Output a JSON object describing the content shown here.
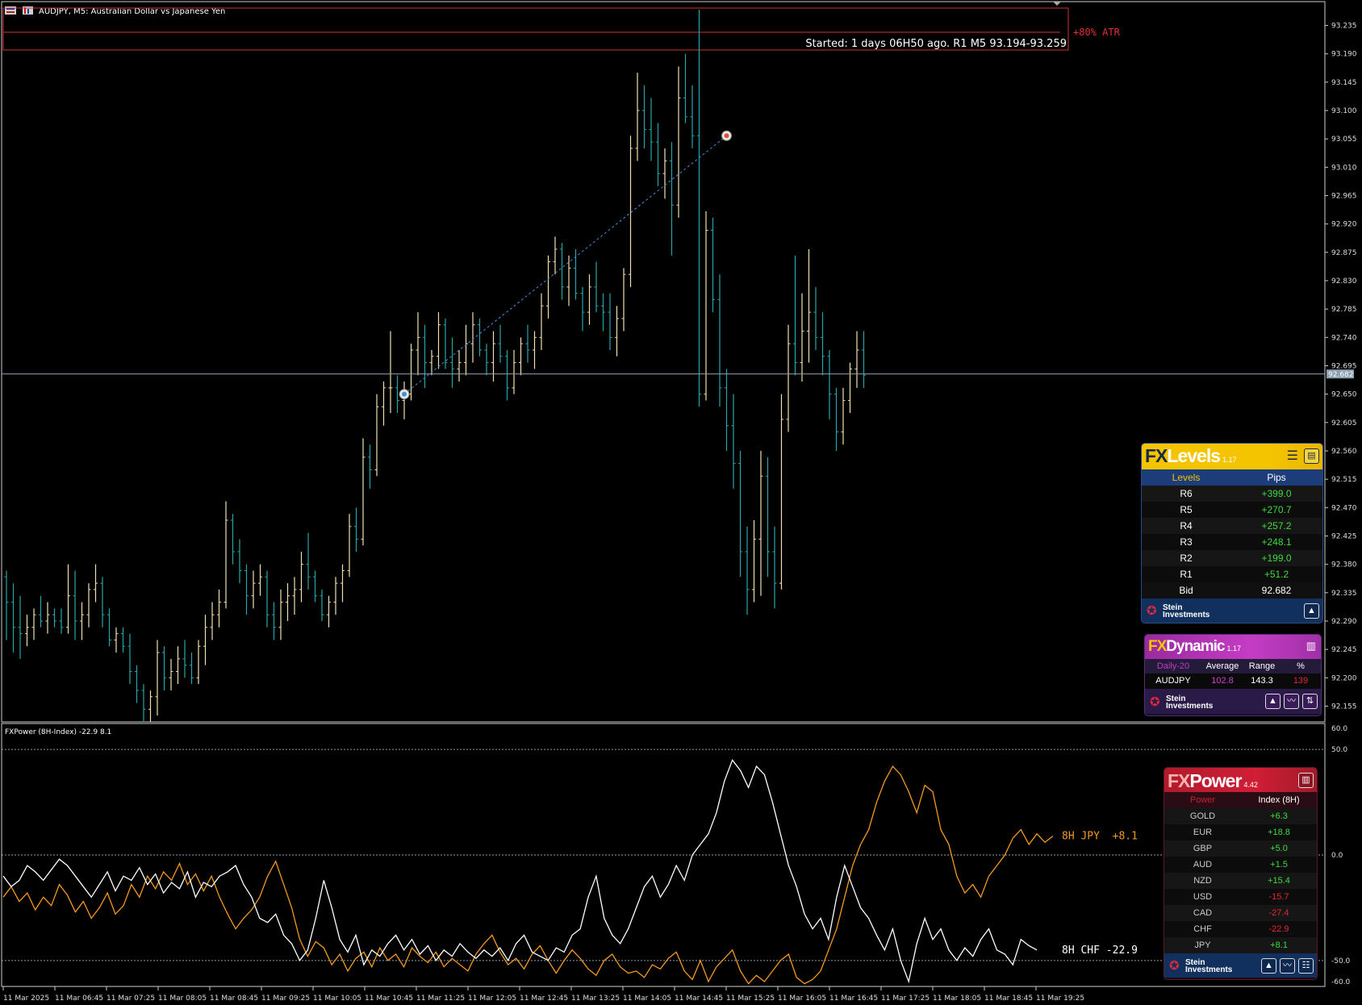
{
  "window": {
    "title": "AUDJPY, M5:  Australian Dollar vs Japanese Yen"
  },
  "colors": {
    "background": "#000000",
    "bull": "#f2deb0",
    "bear": "#26a6a6",
    "grid_line": "#8f9fb2",
    "atr_box": "#d23232",
    "jpy_line": "#f29a1f",
    "chf_line": "#ffffff",
    "fxlevels_accent": "#f5c400",
    "fxdynamic_accent": "#c43cc4",
    "fxpower_accent": "#d01e35"
  },
  "price_axis": {
    "ticks": [
      "93.235",
      "93.190",
      "93.145",
      "93.100",
      "93.055",
      "93.010",
      "92.965",
      "92.920",
      "92.875",
      "92.830",
      "92.785",
      "92.740",
      "92.695",
      "92.650",
      "92.605",
      "92.560",
      "92.515",
      "92.470",
      "92.425",
      "92.380",
      "92.335",
      "92.290",
      "92.245",
      "92.200",
      "92.155"
    ],
    "current_price": "92.682"
  },
  "atr": {
    "label": "+80% ATR",
    "info": "Started: 1 days 06H50 ago. R1 M5 93.194-93.259"
  },
  "time_axis": {
    "ticks": [
      "11 Mar 2025",
      "11 Mar 06:45",
      "11 Mar 07:25",
      "11 Mar 08:05",
      "11 Mar 08:45",
      "11 Mar 09:25",
      "11 Mar 10:05",
      "11 Mar 10:45",
      "11 Mar 11:25",
      "11 Mar 12:05",
      "11 Mar 12:45",
      "11 Mar 13:25",
      "11 Mar 14:05",
      "11 Mar 14:45",
      "11 Mar 15:25",
      "11 Mar 16:05",
      "11 Mar 16:45",
      "11 Mar 17:25",
      "11 Mar 18:05",
      "11 Mar 18:45",
      "11 Mar 19:25"
    ]
  },
  "chart_data": {
    "type": "candlestick",
    "symbol": "AUDJPY",
    "timeframe": "M5",
    "ylim": [
      92.13,
      93.26
    ],
    "candles": [
      [
        92.36,
        92.37,
        92.26,
        92.32
      ],
      [
        92.32,
        92.35,
        92.24,
        92.28
      ],
      [
        92.28,
        92.33,
        92.23,
        92.27
      ],
      [
        92.27,
        92.3,
        92.25,
        92.28
      ],
      [
        92.28,
        92.31,
        92.26,
        92.3
      ],
      [
        92.3,
        92.33,
        92.28,
        92.29
      ],
      [
        92.29,
        92.32,
        92.27,
        92.3
      ],
      [
        92.3,
        92.31,
        92.28,
        92.29
      ],
      [
        92.29,
        92.31,
        92.27,
        92.28
      ],
      [
        92.28,
        92.38,
        92.27,
        92.33
      ],
      [
        92.33,
        92.37,
        92.26,
        92.29
      ],
      [
        92.29,
        92.32,
        92.26,
        92.3
      ],
      [
        92.3,
        92.35,
        92.28,
        92.34
      ],
      [
        92.34,
        92.38,
        92.32,
        92.35
      ],
      [
        92.35,
        92.36,
        92.28,
        92.3
      ],
      [
        92.3,
        92.31,
        92.25,
        92.26
      ],
      [
        92.26,
        92.28,
        92.24,
        92.27
      ],
      [
        92.27,
        92.28,
        92.24,
        92.25
      ],
      [
        92.25,
        92.27,
        92.19,
        92.21
      ],
      [
        92.21,
        92.22,
        92.16,
        92.18
      ],
      [
        92.18,
        92.19,
        92.13,
        92.15
      ],
      [
        92.15,
        92.18,
        92.13,
        92.17
      ],
      [
        92.17,
        92.26,
        92.14,
        92.24
      ],
      [
        92.24,
        92.25,
        92.18,
        92.2
      ],
      [
        92.2,
        92.23,
        92.18,
        92.21
      ],
      [
        92.21,
        92.25,
        92.19,
        92.23
      ],
      [
        92.23,
        92.26,
        92.2,
        92.22
      ],
      [
        92.22,
        92.24,
        92.19,
        92.2
      ],
      [
        92.2,
        92.26,
        92.19,
        92.25
      ],
      [
        92.25,
        92.3,
        92.22,
        92.28
      ],
      [
        92.28,
        92.32,
        92.26,
        92.3
      ],
      [
        92.3,
        92.34,
        92.28,
        92.32
      ],
      [
        92.32,
        92.48,
        92.31,
        92.45
      ],
      [
        92.45,
        92.46,
        92.38,
        92.4
      ],
      [
        92.4,
        92.42,
        92.35,
        92.37
      ],
      [
        92.37,
        92.38,
        92.3,
        92.33
      ],
      [
        92.33,
        92.37,
        92.31,
        92.35
      ],
      [
        92.35,
        92.38,
        92.33,
        92.36
      ],
      [
        92.36,
        92.37,
        92.28,
        92.3
      ],
      [
        92.3,
        92.32,
        92.26,
        92.28
      ],
      [
        92.28,
        92.34,
        92.26,
        92.32
      ],
      [
        92.32,
        92.35,
        92.29,
        92.33
      ],
      [
        92.33,
        92.36,
        92.3,
        92.34
      ],
      [
        92.34,
        92.4,
        92.32,
        92.38
      ],
      [
        92.38,
        92.43,
        92.34,
        92.36
      ],
      [
        92.36,
        92.37,
        92.32,
        92.33
      ],
      [
        92.33,
        92.34,
        92.29,
        92.3
      ],
      [
        92.3,
        92.33,
        92.28,
        92.32
      ],
      [
        92.32,
        92.36,
        92.3,
        92.35
      ],
      [
        92.35,
        92.38,
        92.32,
        92.37
      ],
      [
        92.37,
        92.46,
        92.36,
        92.44
      ],
      [
        92.44,
        92.47,
        92.4,
        92.42
      ],
      [
        92.42,
        92.58,
        92.41,
        92.55
      ],
      [
        92.55,
        92.57,
        92.5,
        92.53
      ],
      [
        92.53,
        92.65,
        92.52,
        92.63
      ],
      [
        92.63,
        92.67,
        92.6,
        92.66
      ],
      [
        92.66,
        92.75,
        92.62,
        92.66
      ],
      [
        92.66,
        92.68,
        92.62,
        92.64
      ],
      [
        92.64,
        92.67,
        92.61,
        92.65
      ],
      [
        92.65,
        92.73,
        92.64,
        92.72
      ],
      [
        92.72,
        92.78,
        92.68,
        92.74
      ],
      [
        92.74,
        92.76,
        92.66,
        92.7
      ],
      [
        92.7,
        92.72,
        92.68,
        92.71
      ],
      [
        92.71,
        92.78,
        92.69,
        92.76
      ],
      [
        92.76,
        92.77,
        92.69,
        92.7
      ],
      [
        92.7,
        92.74,
        92.66,
        92.69
      ],
      [
        92.69,
        92.72,
        92.67,
        92.7
      ],
      [
        92.7,
        92.76,
        92.68,
        92.73
      ],
      [
        92.73,
        92.78,
        92.7,
        92.76
      ],
      [
        92.76,
        92.77,
        92.71,
        92.72
      ],
      [
        92.72,
        92.73,
        92.68,
        92.7
      ],
      [
        92.7,
        92.75,
        92.67,
        92.73
      ],
      [
        92.73,
        92.76,
        92.7,
        92.71
      ],
      [
        92.71,
        92.72,
        92.64,
        92.66
      ],
      [
        92.66,
        92.72,
        92.65,
        92.7
      ],
      [
        92.7,
        92.74,
        92.68,
        92.73
      ],
      [
        92.73,
        92.76,
        92.7,
        92.72
      ],
      [
        92.72,
        92.75,
        92.69,
        92.74
      ],
      [
        92.74,
        92.81,
        92.72,
        92.79
      ],
      [
        92.79,
        92.87,
        92.77,
        92.86
      ],
      [
        92.86,
        92.9,
        92.84,
        92.88
      ],
      [
        92.88,
        92.89,
        92.8,
        92.82
      ],
      [
        92.82,
        92.87,
        92.79,
        92.85
      ],
      [
        92.85,
        92.88,
        92.8,
        92.81
      ],
      [
        92.81,
        92.82,
        92.75,
        92.78
      ],
      [
        92.78,
        92.84,
        92.76,
        92.82
      ],
      [
        92.82,
        92.86,
        92.78,
        92.79
      ],
      [
        92.79,
        92.81,
        92.75,
        92.78
      ],
      [
        92.78,
        92.81,
        92.72,
        92.74
      ],
      [
        92.74,
        92.79,
        92.71,
        92.77
      ],
      [
        92.77,
        92.85,
        92.75,
        92.84
      ],
      [
        92.84,
        93.06,
        92.82,
        93.04
      ],
      [
        93.04,
        93.16,
        93.02,
        93.1
      ],
      [
        93.1,
        93.14,
        93.04,
        93.07
      ],
      [
        93.07,
        93.12,
        93.02,
        93.05
      ],
      [
        93.05,
        93.08,
        92.98,
        93.0
      ],
      [
        93.0,
        93.04,
        92.96,
        93.02
      ],
      [
        93.02,
        93.05,
        92.87,
        92.95
      ],
      [
        92.95,
        93.17,
        92.93,
        93.12
      ],
      [
        93.12,
        93.19,
        93.08,
        93.09
      ],
      [
        93.09,
        93.14,
        93.04,
        93.06
      ],
      [
        93.06,
        93.26,
        92.63,
        92.65
      ],
      [
        92.65,
        92.94,
        92.64,
        92.91
      ],
      [
        92.91,
        92.93,
        92.78,
        92.8
      ],
      [
        92.8,
        92.84,
        92.63,
        92.66
      ],
      [
        92.66,
        92.69,
        92.56,
        92.6
      ],
      [
        92.6,
        92.65,
        92.5,
        92.54
      ],
      [
        92.54,
        92.56,
        92.36,
        92.4
      ],
      [
        92.4,
        92.44,
        92.3,
        92.34
      ],
      [
        92.34,
        92.45,
        92.32,
        92.42
      ],
      [
        92.42,
        92.56,
        92.33,
        92.52
      ],
      [
        92.52,
        92.55,
        92.36,
        92.4
      ],
      [
        92.4,
        92.44,
        92.31,
        92.35
      ],
      [
        92.35,
        92.65,
        92.34,
        92.61
      ],
      [
        92.61,
        92.76,
        92.59,
        92.73
      ],
      [
        92.73,
        92.87,
        92.68,
        92.7
      ],
      [
        92.7,
        92.81,
        92.67,
        92.75
      ],
      [
        92.75,
        92.88,
        92.7,
        92.78
      ],
      [
        92.78,
        92.82,
        92.72,
        92.74
      ],
      [
        92.74,
        92.78,
        92.68,
        92.71
      ],
      [
        92.71,
        92.72,
        92.61,
        92.65
      ],
      [
        92.65,
        92.66,
        92.56,
        92.59
      ],
      [
        92.59,
        92.66,
        92.57,
        92.64
      ],
      [
        92.64,
        92.7,
        92.62,
        92.69
      ],
      [
        92.69,
        92.75,
        92.66,
        92.72
      ],
      [
        92.72,
        92.75,
        92.66,
        92.68
      ]
    ],
    "current_price": 92.682,
    "trend_line": {
      "from_candle": 58,
      "to_candle": 105,
      "from_price": 92.65,
      "to_price": 93.06
    }
  },
  "indicator": {
    "title": "FXPower (8H-Index) -22.9 8.1",
    "axis_ticks": [
      "60.0",
      "50.0",
      "0.0",
      "-50.0",
      "-60.0"
    ],
    "ylim": [
      -60,
      60
    ],
    "levels": [
      50,
      0,
      -50
    ],
    "jpy_label": "8H JPY  +8.1",
    "chf_label": "8H CHF -22.9",
    "chart_data": {
      "type": "line",
      "series": [
        {
          "name": "8H JPY",
          "values": [
            -20,
            -15,
            -22,
            -18,
            -26,
            -20,
            -24,
            -14,
            -19,
            -27,
            -22,
            -30,
            -25,
            -18,
            -28,
            -24,
            -14,
            -20,
            -10,
            -16,
            -8,
            -12,
            -4,
            -14,
            -9,
            -17,
            -10,
            -20,
            -28,
            -35,
            -30,
            -26,
            -20,
            -10,
            -3,
            -14,
            -25,
            -40,
            -48,
            -41,
            -44,
            -52,
            -47,
            -55,
            -49,
            -46,
            -53,
            -44,
            -50,
            -47,
            -53,
            -44,
            -48,
            -51,
            -46,
            -53,
            -49,
            -52,
            -55,
            -47,
            -42,
            -38,
            -46,
            -52,
            -49,
            -54,
            -47,
            -43,
            -50,
            -56,
            -50,
            -45,
            -49,
            -54,
            -57,
            -50,
            -47,
            -53,
            -56,
            -55,
            -58,
            -52,
            -54,
            -49,
            -46,
            -55,
            -59,
            -50,
            -60,
            -53,
            -49,
            -45,
            -55,
            -61,
            -57,
            -60,
            -55,
            -50,
            -47,
            -58,
            -61,
            -59,
            -55,
            -45,
            -35,
            -20,
            -5,
            5,
            12,
            25,
            35,
            42,
            38,
            30,
            20,
            33,
            30,
            12,
            5,
            -10,
            -18,
            -14,
            -20,
            -10,
            -5,
            0,
            8,
            12,
            5,
            10,
            6,
            9
          ],
          "color": "#f29a1f"
        },
        {
          "name": "8H CHF",
          "values": [
            -10,
            -15,
            -12,
            -5,
            -8,
            -12,
            -7,
            -2,
            -5,
            -10,
            -15,
            -20,
            -14,
            -8,
            -17,
            -10,
            -12,
            -6,
            -14,
            -9,
            -18,
            -13,
            -16,
            -8,
            -20,
            -13,
            -15,
            -10,
            -8,
            -5,
            -14,
            -20,
            -30,
            -32,
            -28,
            -38,
            -42,
            -50,
            -45,
            -30,
            -12,
            -25,
            -40,
            -46,
            -38,
            -52,
            -45,
            -48,
            -42,
            -38,
            -45,
            -40,
            -47,
            -43,
            -50,
            -45,
            -48,
            -42,
            -46,
            -49,
            -45,
            -48,
            -44,
            -50,
            -42,
            -38,
            -46,
            -48,
            -50,
            -44,
            -46,
            -38,
            -35,
            -20,
            -10,
            -30,
            -38,
            -42,
            -35,
            -25,
            -15,
            -10,
            -20,
            -14,
            -5,
            -12,
            0,
            5,
            10,
            20,
            35,
            45,
            40,
            32,
            42,
            38,
            25,
            10,
            -5,
            -15,
            -28,
            -35,
            -30,
            -40,
            -20,
            -5,
            -15,
            -25,
            -30,
            -38,
            -45,
            -35,
            -50,
            -60,
            -42,
            -30,
            -40,
            -35,
            -45,
            -50,
            -44,
            -48,
            -40,
            -35,
            -45,
            -47,
            -52,
            -40,
            -43,
            -45
          ],
          "color": "#ffffff"
        }
      ]
    }
  },
  "fxlevels": {
    "fx": "FX",
    "name": "Levels",
    "version": "1.17",
    "col1": "Levels",
    "col2": "Pips",
    "rows": [
      {
        "level": "R6",
        "pips": "+399.0"
      },
      {
        "level": "R5",
        "pips": "+270.7"
      },
      {
        "level": "R4",
        "pips": "+257.2"
      },
      {
        "level": "R3",
        "pips": "+248.1"
      },
      {
        "level": "R2",
        "pips": "+199.0"
      },
      {
        "level": "R1",
        "pips": "+51.2"
      }
    ],
    "bid_label": "Bid",
    "bid_value": "92.682",
    "brand1": "Stein",
    "brand2": "Investments"
  },
  "fxdynamic": {
    "fx": "FX",
    "name": "Dynamic",
    "version": "1.17",
    "h1": "Daily-20",
    "h2": "Average",
    "h3": "Range",
    "h4": "%",
    "symbol": "AUDJPY",
    "average": "102.8",
    "range": "143.3",
    "pct": "139",
    "brand1": "Stein",
    "brand2": "Investments"
  },
  "fxpower": {
    "fx": "FX",
    "name": "Power",
    "version": "4.42",
    "col1": "Power",
    "col2": "Index (8H)",
    "rows": [
      {
        "name": "GOLD",
        "value": "+6.3",
        "color": "#3ddc3d"
      },
      {
        "name": "EUR",
        "value": "+18.8",
        "color": "#3ddc3d"
      },
      {
        "name": "GBP",
        "value": "+5.0",
        "color": "#3ddc3d"
      },
      {
        "name": "AUD",
        "value": "+1.5",
        "color": "#3ddc3d"
      },
      {
        "name": "NZD",
        "value": "+15.4",
        "color": "#3ddc3d"
      },
      {
        "name": "USD",
        "value": "-15.7",
        "color": "#e0283a"
      },
      {
        "name": "CAD",
        "value": "-27.4",
        "color": "#e0283a"
      },
      {
        "name": "CHF",
        "value": "-22.9",
        "color": "#e0283a"
      },
      {
        "name": "JPY",
        "value": "+8.1",
        "color": "#3ddc3d"
      }
    ],
    "brand1": "Stein",
    "brand2": "Investments"
  }
}
